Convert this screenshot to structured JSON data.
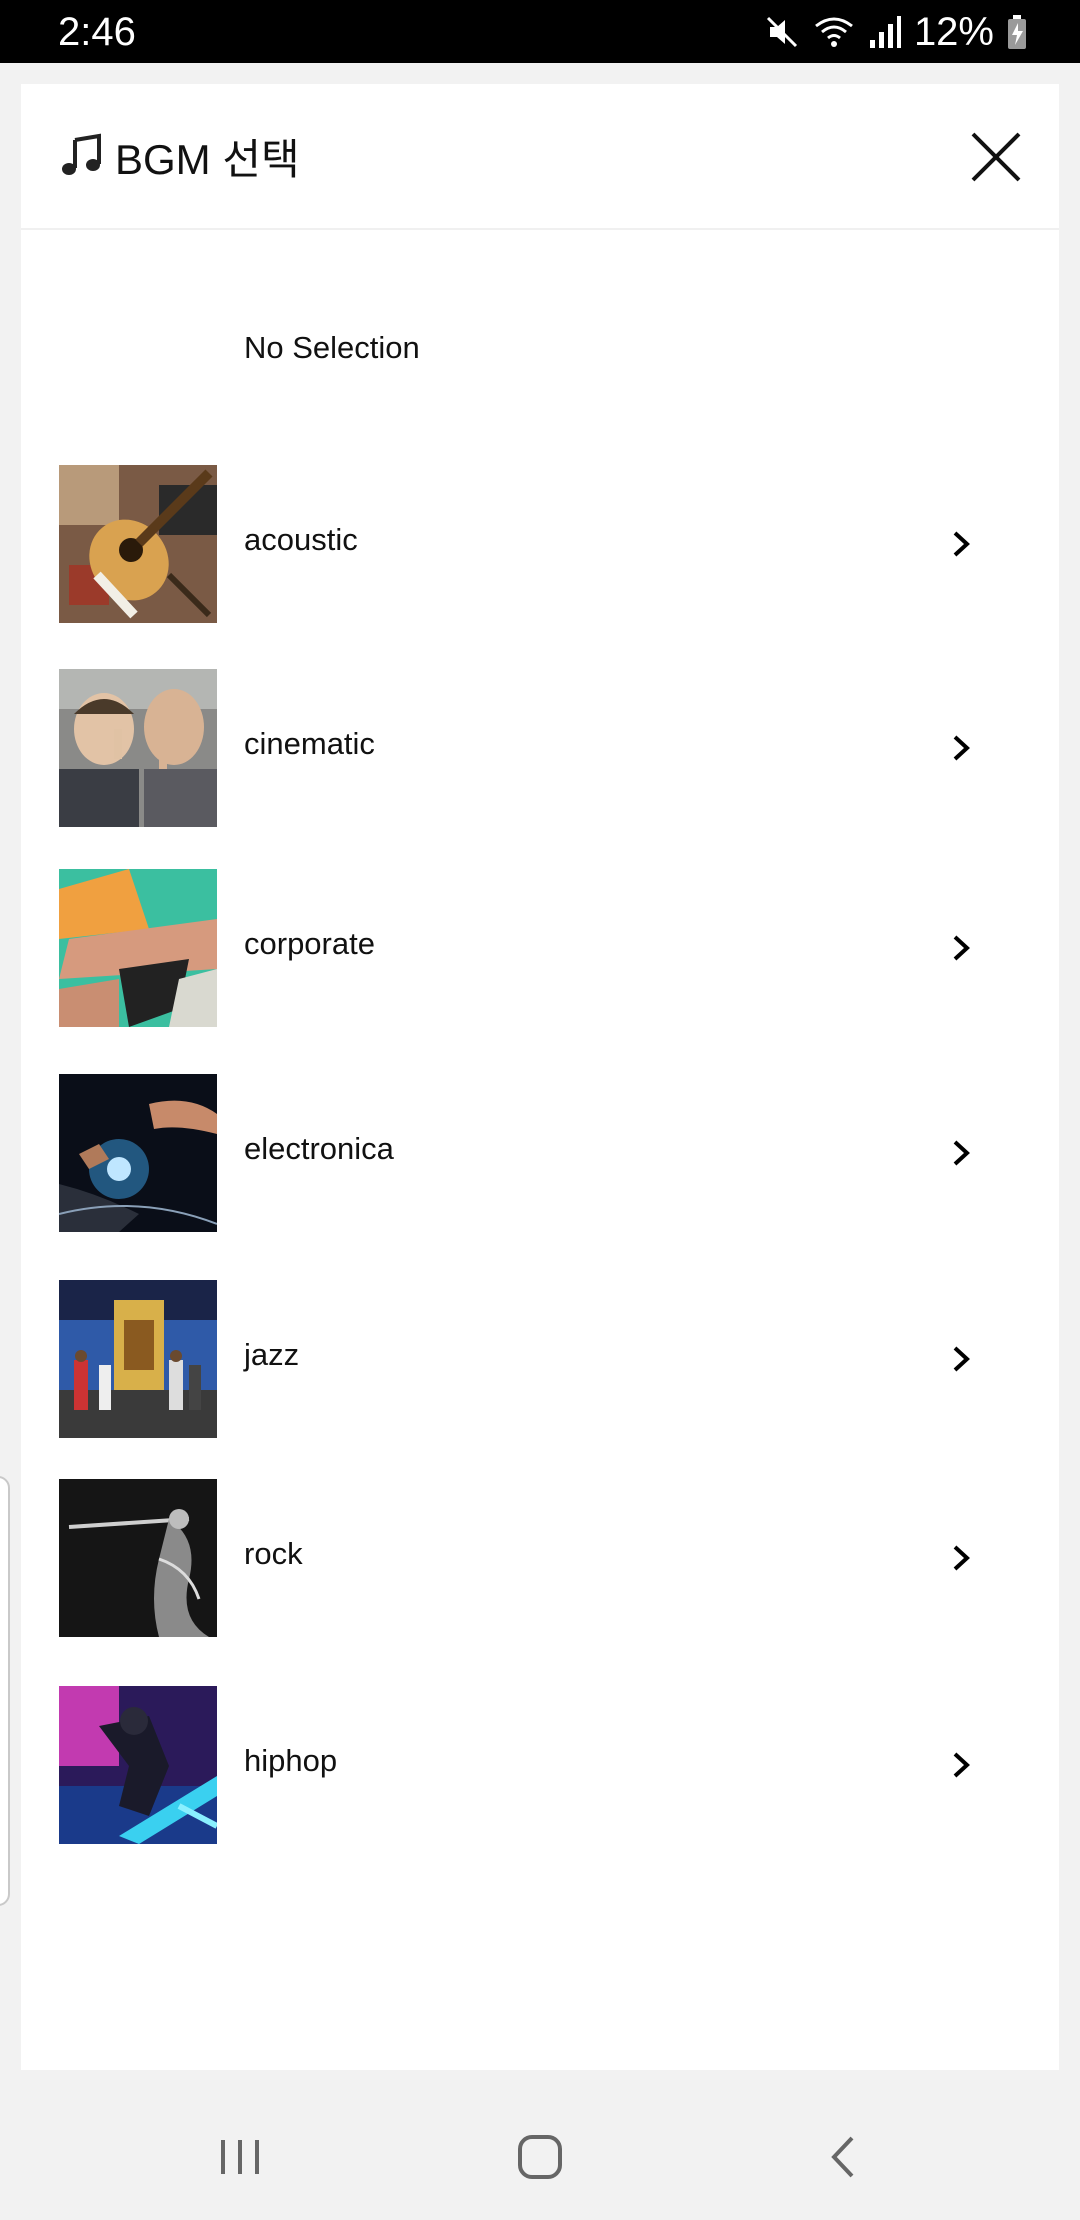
{
  "status_bar": {
    "time": "2:46",
    "battery": "12%",
    "icons": [
      "mute-icon",
      "wifi-icon",
      "signal-icon",
      "battery-charging-icon"
    ]
  },
  "sheet": {
    "title_icon": "music-note-icon",
    "title": "BGM 선택",
    "close_icon": "close-icon"
  },
  "no_selection": {
    "label": "No Selection"
  },
  "genres": [
    {
      "label": "acoustic",
      "thumb_icon": "acoustic-guitar-thumbnail"
    },
    {
      "label": "cinematic",
      "thumb_icon": "cinematic-thumbnail"
    },
    {
      "label": "corporate",
      "thumb_icon": "corporate-thumbnail"
    },
    {
      "label": "electronica",
      "thumb_icon": "electronica-thumbnail"
    },
    {
      "label": "jazz",
      "thumb_icon": "jazz-thumbnail"
    },
    {
      "label": "rock",
      "thumb_icon": "rock-thumbnail"
    },
    {
      "label": "hiphop",
      "thumb_icon": "hiphop-thumbnail"
    }
  ],
  "nav_bar": {
    "buttons": [
      "recent-apps-icon",
      "home-icon",
      "back-icon"
    ]
  }
}
